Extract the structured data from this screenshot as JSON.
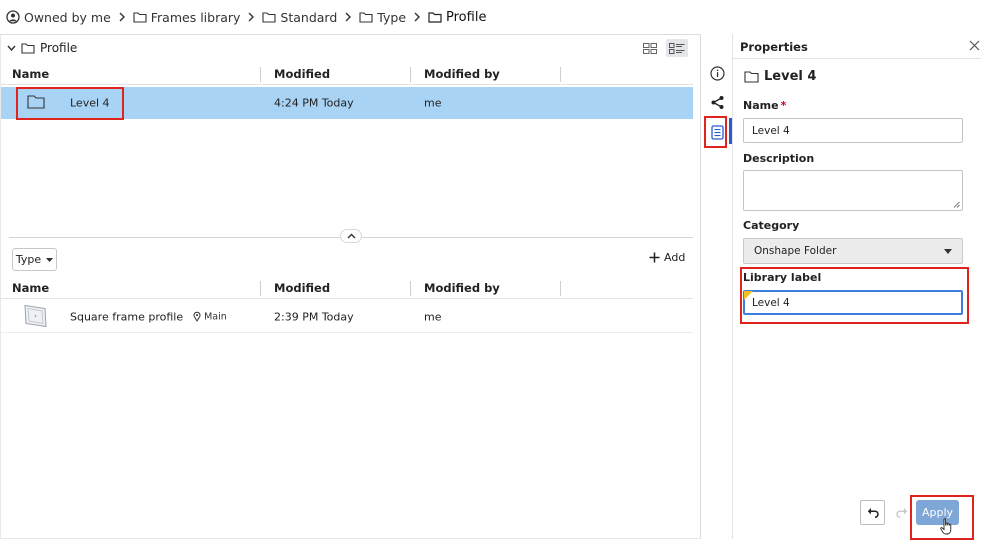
{
  "breadcrumb": {
    "items": [
      {
        "label": "Owned by me",
        "icon": "user-circle-icon"
      },
      {
        "label": "Frames library",
        "icon": "folder-icon"
      },
      {
        "label": "Standard",
        "icon": "folder-icon"
      },
      {
        "label": "Type",
        "icon": "folder-icon"
      },
      {
        "label": "Profile",
        "icon": "folder-icon"
      }
    ]
  },
  "folder_header": {
    "label": "Profile"
  },
  "top_table": {
    "columns": [
      "Name",
      "Modified",
      "Modified by"
    ],
    "rows": [
      {
        "name": "Level 4",
        "modified": "4:24 PM Today",
        "modified_by": "me",
        "icon": "folder-icon",
        "selected": true
      }
    ]
  },
  "filter": {
    "type_label": "Type",
    "add_label": "Add"
  },
  "bottom_table": {
    "columns": [
      "Name",
      "Modified",
      "Modified by"
    ],
    "rows": [
      {
        "name": "Square frame profile",
        "branch": "Main",
        "modified": "2:39 PM Today",
        "modified_by": "me",
        "icon": "part-thumbnail-icon"
      }
    ]
  },
  "rail": {
    "icons": [
      "info-icon",
      "share-icon",
      "properties-icon"
    ],
    "active": "properties-icon"
  },
  "properties": {
    "title": "Properties",
    "item_name": "Level 4",
    "name_label": "Name",
    "required_mark": "*",
    "name_value": "Level 4",
    "description_label": "Description",
    "description_value": "",
    "category_label": "Category",
    "category_value": "Onshape Folder",
    "library_label": "Library label",
    "library_value": "Level 4",
    "apply_label": "Apply"
  },
  "colors": {
    "selected_row": "#a9d3f5",
    "highlight": "#e0231c",
    "apply_button": "#7ea6d6",
    "active_tab": "#2a5bd7",
    "change_flag": "#f2c01c"
  }
}
